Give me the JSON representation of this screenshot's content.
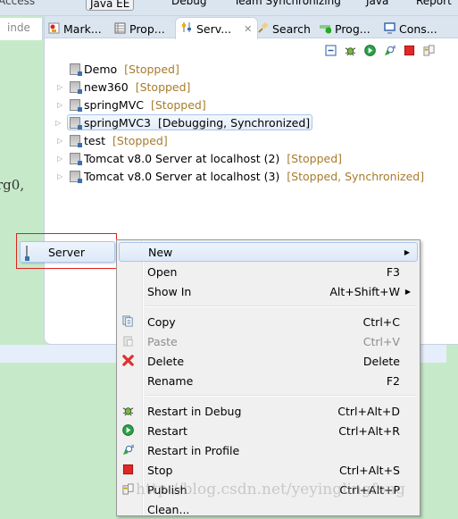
{
  "perspectives": [
    "Access",
    "Java EE",
    "Debug",
    "Team Synchronizing",
    "Java",
    "Report"
  ],
  "editor_tab": "inde",
  "editor_fragment": "rg0,",
  "tabs": [
    {
      "label": "Mark...",
      "icon": "markers-icon"
    },
    {
      "label": "Prop...",
      "icon": "properties-icon"
    },
    {
      "label": "Serv...",
      "icon": "servers-icon",
      "active": true
    },
    {
      "label": "Search",
      "icon": "search-icon"
    },
    {
      "label": "Prog...",
      "icon": "progress-icon"
    },
    {
      "label": "Cons...",
      "icon": "console-icon"
    }
  ],
  "toolbar": [
    "collapse-all-icon",
    "debug-icon",
    "start-icon",
    "profile-icon",
    "stop-icon",
    "publish-icon"
  ],
  "servers": [
    {
      "name": "Demo",
      "status": "[Stopped]",
      "expandable": false
    },
    {
      "name": "new360",
      "status": "[Stopped]",
      "expandable": true
    },
    {
      "name": "springMVC",
      "status": "[Stopped]",
      "expandable": true
    },
    {
      "name": "springMVC3",
      "status": "[Debugging, Synchronized]",
      "expandable": true,
      "selected": true
    },
    {
      "name": "test",
      "status": "[Stopped]",
      "expandable": true
    },
    {
      "name": "Tomcat v8.0 Server at localhost (2)",
      "status": "[Stopped]",
      "expandable": true
    },
    {
      "name": "Tomcat v8.0 Server at localhost (3)",
      "status": "[Stopped, Synchronized]",
      "expandable": true
    }
  ],
  "submenu": {
    "label": "Server"
  },
  "menu": [
    {
      "label": "New",
      "shortcut": "",
      "submenu": true,
      "highlighted": true
    },
    {
      "label": "Open",
      "shortcut": "F3"
    },
    {
      "label": "Show In",
      "shortcut": "Alt+Shift+W",
      "submenu": true
    },
    {
      "sep": true
    },
    {
      "label": "Copy",
      "shortcut": "Ctrl+C",
      "icon": "copy-icon"
    },
    {
      "label": "Paste",
      "shortcut": "Ctrl+V",
      "icon": "paste-icon",
      "disabled": true
    },
    {
      "label": "Delete",
      "shortcut": "Delete",
      "icon": "delete-icon"
    },
    {
      "label": "Rename",
      "shortcut": "F2"
    },
    {
      "sep": true
    },
    {
      "label": "Restart in Debug",
      "shortcut": "Ctrl+Alt+D",
      "icon": "debug-icon"
    },
    {
      "label": "Restart",
      "shortcut": "Ctrl+Alt+R",
      "icon": "start-icon"
    },
    {
      "label": "Restart in Profile",
      "shortcut": "",
      "icon": "profile-icon"
    },
    {
      "label": "Stop",
      "shortcut": "Ctrl+Alt+S",
      "icon": "stop-icon"
    },
    {
      "label": "Publish",
      "shortcut": "Ctrl+Alt+P",
      "icon": "publish-icon"
    },
    {
      "label": "Clean...",
      "shortcut": ""
    }
  ],
  "watermark": "http://blog.csdn.net/yeyinglingfeng",
  "colors": {
    "status": "#a77b2c",
    "highlight": "#dde9f8",
    "annotation": "#e02020",
    "editor_bg": "#c6eac9"
  }
}
